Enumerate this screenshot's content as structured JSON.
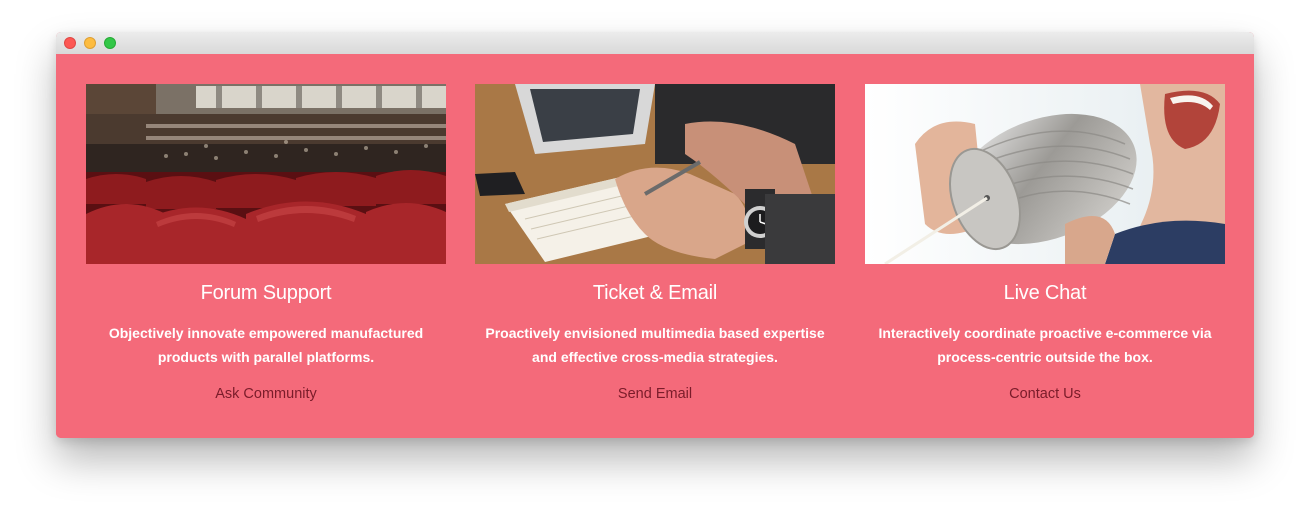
{
  "window": {
    "controls": [
      "close",
      "minimize",
      "zoom"
    ],
    "background_color": "#f46a7a"
  },
  "cards": [
    {
      "image_subject": "auditorium with red seats",
      "title": "Forum Support",
      "description_line1": "Objectively innovate empowered manufactured",
      "description_line2": "products with parallel platforms.",
      "link": "Ask Community"
    },
    {
      "image_subject": "hand writing in notebook beside laptop",
      "title": "Ticket & Email",
      "description_line1": "Proactively envisioned multimedia based expertise",
      "description_line2": "and effective cross-media strategies.",
      "link": "Send Email"
    },
    {
      "image_subject": "person shouting into tin can phone",
      "title": "Live Chat",
      "description_line1": "Interactively coordinate proactive e-commerce via",
      "description_line2": "process-centric outside the box.",
      "link": "Contact Us"
    }
  ],
  "colors": {
    "accent": "#f46a7a",
    "heading_text": "#ffffff",
    "link_text": "#7a1c2a"
  }
}
